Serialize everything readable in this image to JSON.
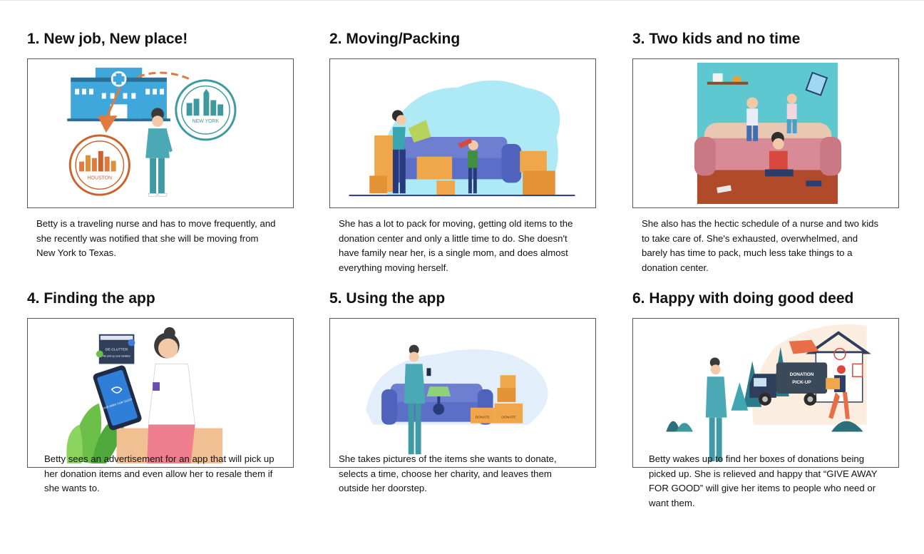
{
  "panels": [
    {
      "title": "1. New job, New place!",
      "caption": "Betty is a traveling nurse and has to move frequently, and she recently was notified that she will be moving from New York to Texas.",
      "labels": [
        "NEW YORK",
        "HOUSTON"
      ]
    },
    {
      "title": "2. Moving/Packing",
      "caption": "She has a lot to pack for moving, getting old items to the donation center and only a little time to do. She doesn't have family near her, is a single mom, and does almost everything moving herself."
    },
    {
      "title": "3. Two kids and no time",
      "caption": "She also has the hectic schedule of a nurse and two kids to take care of. She's exhausted, overwhelmed, and barely has time to pack, much less take things to a donation center."
    },
    {
      "title": "4. Finding the app",
      "caption": "Betty sees an advertisement for an app that will pick up her donation items and even allow her to resale them if she wants to.",
      "labels": [
        "DE-CLUTTER",
        "We pick up your donation",
        "GIVE AWAY FOR GOOD"
      ]
    },
    {
      "title": "5. Using the app",
      "caption": "She takes pictures of the items she wants to donate, selects a time, choose her charity, and leaves them outside her doorstep.",
      "labels": [
        "DONATE",
        "DONATE"
      ]
    },
    {
      "title": "6. Happy with doing good deed",
      "caption": "Betty wakes up to find her boxes of donations being picked up. She is relieved and happy that “GIVE AWAY FOR GOOD” will give her items to people who need or want them.",
      "labels": [
        "DONATION",
        "PICK-UP"
      ]
    }
  ],
  "colors": {
    "frame_border": "#555555",
    "teal": "#3fa7b4",
    "orange": "#e07a3f",
    "box": "#f0a64b",
    "sofa": "#5b6fc9"
  }
}
